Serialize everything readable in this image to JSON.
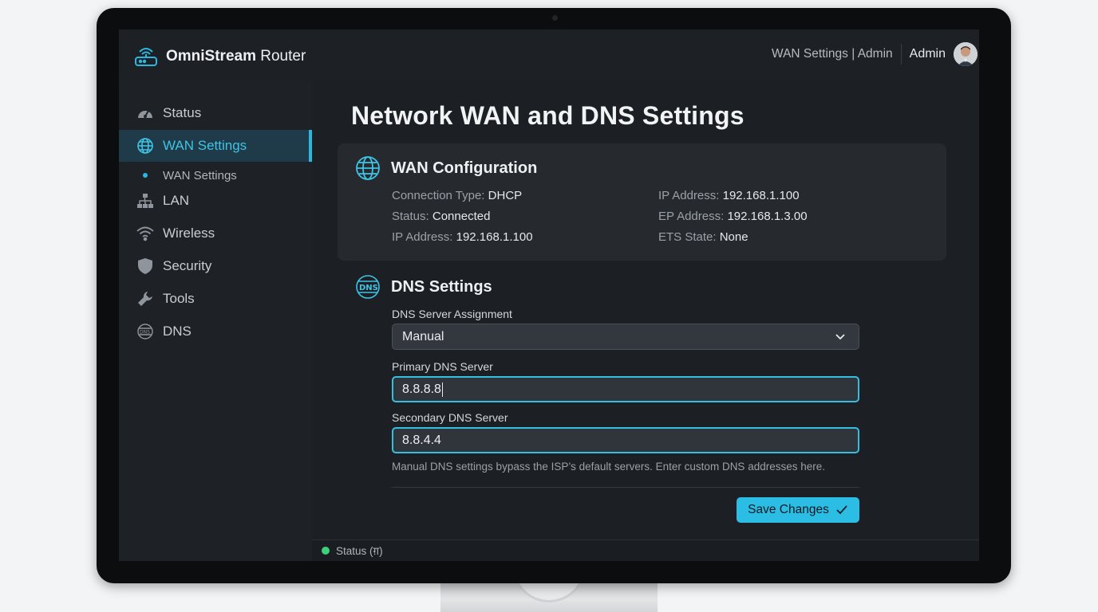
{
  "brand": {
    "name_bold": "OmniStream",
    "name_rest": " Router"
  },
  "header": {
    "page_label": "WAN Settings | Admin",
    "user_name": "Admin"
  },
  "sidebar": {
    "items": [
      {
        "label": "Status",
        "icon": "gauge-icon"
      },
      {
        "label": "WAN Settings",
        "icon": "globe-icon",
        "active": true
      },
      {
        "label": "LAN",
        "icon": "network-tree-icon"
      },
      {
        "label": "Wireless",
        "icon": "wifi-icon"
      },
      {
        "label": "Security",
        "icon": "shield-icon"
      },
      {
        "label": "Tools",
        "icon": "wrench-icon"
      },
      {
        "label": "DNS",
        "icon": "dns-globe-icon"
      }
    ],
    "sub_item": {
      "label": "WAN Settings"
    }
  },
  "main": {
    "title": "Network WAN and DNS Settings",
    "wan": {
      "heading": "WAN Configuration",
      "left": [
        {
          "key": "Connection Type:",
          "value": "DHCP"
        },
        {
          "key": "Status:",
          "value": "Connected"
        },
        {
          "key": "IP Address:",
          "value": "192.168.1.100"
        }
      ],
      "right": [
        {
          "key": "IP Address:",
          "value": "192.168.1.100"
        },
        {
          "key": "EP Address:",
          "value": "192.168.1.3.00"
        },
        {
          "key": "ETS State:",
          "value": "None"
        }
      ]
    },
    "dns": {
      "heading": "DNS Settings",
      "assignment_label": "DNS Server Assignment",
      "assignment_value": "Manual",
      "primary_label": "Primary DNS Server",
      "primary_value": "8.8.8.8",
      "secondary_label": "Secondary DNS Server",
      "secondary_value": "8.8.4.4",
      "hint": "Manual DNS settings bypass the ISP’s default servers. Enter custom DNS addresses here.",
      "save_label": "Save Changes"
    }
  },
  "statusbar": {
    "label": "Status (ग़)"
  },
  "colors": {
    "accent": "#2bb8e0",
    "status_ok": "#3ecf7a",
    "background": "#1c1f23"
  }
}
